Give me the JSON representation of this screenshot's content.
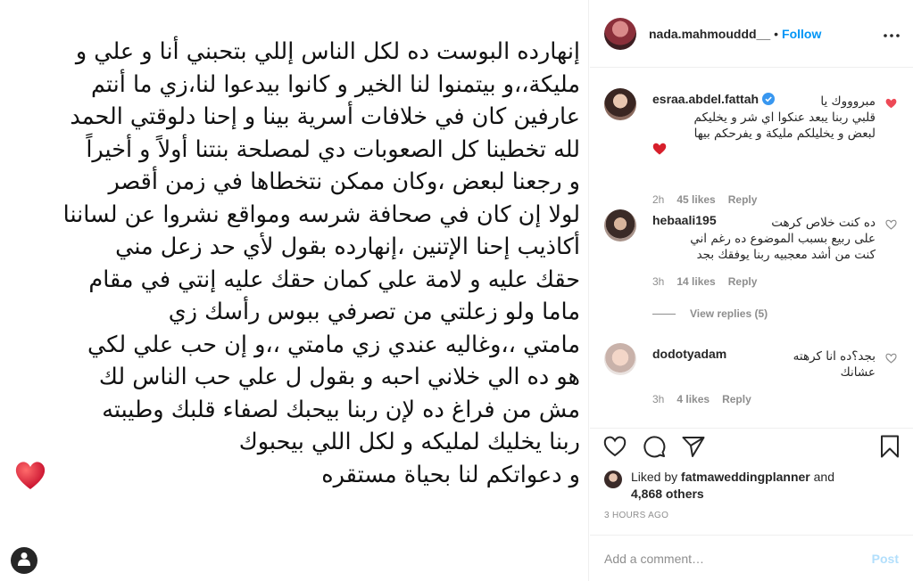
{
  "post": {
    "caption": "إنهارده البوست ده لكل الناس  إللي بتحبني أنا و علي و\nمليكة،،و بيتمنوا لنا الخير و كانوا بيدعوا لنا،زي ما أنتم\nعارفين كان في خلافات أسرية بينا و إحنا دلوقتي الحمد\nلله تخطينا كل الصعوبات دي لمصلحة بنتنا أولاً و أخيراً\nو رجعنا لبعض ،وكان ممكن نتخطاها في زمن أقصر\nلولا إن كان في صحافة شرسه ومواقع نشروا عن لساننا\nأكاذيب إحنا الإتنين ،إنهارده بقول لأي حد زعل مني\nحقك عليه و لامة علي كمان حقك عليه إنتي في مقام\nماما ولو زعلتي من تصرفي  ببوس رأسك زي\nمامتي ،،وغاليه عندي زي مامتي ،،و إن حب علي لكي\nهو ده الي خلاني احبه و بقول ل علي حب الناس لك\nمش من فراغ ده لإن ربنا بيحبك لصفاء قلبك وطيبته\nربنا يخليك لمليكه و لكل اللي بيحبوك\nو دعواتكم لنا بحياة مستقره",
    "emoji_icon": "red-heart-icon",
    "user_tag_icon": "user-icon"
  },
  "header": {
    "username": "nada.mahmouddd__",
    "separator": "•",
    "follow_label": "Follow",
    "more_icon": "more-icon"
  },
  "comments": [
    {
      "username": "esraa.abdel.fattah",
      "verified": true,
      "text": "مبروووك يا\nقلبي ربنا يبعد عنكوا اي شر و يخليكم\nلبعض و يخليلكم مليكة و يفرحكم بيها",
      "time": "2h",
      "likes": "45 likes",
      "reply": "Reply",
      "liked": true
    },
    {
      "username": "hebaali195",
      "verified": false,
      "text": "ده كنت خلاص كرهت\nعلى ربيع بسبب الموضوع ده رغم اني\nكنت من أشد معجبيه ربنا يوفقك بجد",
      "time": "3h",
      "likes": "14 likes",
      "reply": "Reply",
      "liked": false
    },
    {
      "username": "dodotyadam",
      "verified": false,
      "text": "بجد؟ده انا كرهته\nعشانك",
      "time": "3h",
      "likes": "4 likes",
      "reply": "Reply",
      "liked": false
    }
  ],
  "view_replies": "View replies (5)",
  "liked_by": {
    "prefix": "Liked by",
    "user": "fatmaweddingplanner",
    "and": "and",
    "others": "4,868 others"
  },
  "timestamp": "3 HOURS AGO",
  "add_comment": {
    "placeholder": "Add a comment…",
    "post_label": "Post"
  },
  "colors": {
    "accent": "#0095f6",
    "like_red": "#ed4956",
    "muted": "#8e8e8e"
  }
}
